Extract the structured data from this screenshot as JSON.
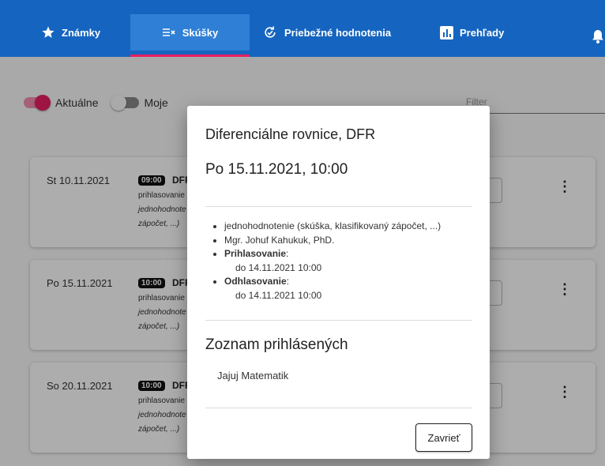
{
  "nav": {
    "tabs": [
      {
        "label": "Známky",
        "icon": "star-icon"
      },
      {
        "label": "Skúšky",
        "icon": "list-check-icon"
      },
      {
        "label": "Priebežné hodnotenia",
        "icon": "refresh-check-icon"
      },
      {
        "label": "Prehľady",
        "icon": "chart-box-icon"
      }
    ],
    "active_tab": "Skúšky",
    "colors": {
      "bar": "#1565c0",
      "active": "#2f7fd6",
      "accent": "#e91e63"
    }
  },
  "filters": {
    "current_label": "Aktuálne",
    "current_on": true,
    "mine_label": "Moje",
    "mine_on": false,
    "filter_placeholder": "Filter"
  },
  "exams": [
    {
      "date": "St 10.11.2021",
      "time": "09:00",
      "code": "DFR",
      "line1": "prihlasovanie",
      "line2": "jednohodnote",
      "line3": "zápočet, ...)"
    },
    {
      "date": "Po 15.11.2021",
      "time": "10:00",
      "code": "DFR",
      "line1": "prihlasovanie",
      "line2": "jednohodnote",
      "line3": "zápočet, ...)"
    },
    {
      "date": "So 20.11.2021",
      "time": "10:00",
      "code": "DFR",
      "line1": "prihlasovanie",
      "line2": "jednohodnote",
      "line3": "zápočet, ...)"
    }
  ],
  "dialog": {
    "title": "Diferenciálne rovnice, DFR",
    "datetime": "Po 15.11.2021, 10:00",
    "details": {
      "type": "jednohodnotenie (skúška, klasifikovaný zápočet, ...)",
      "examiner": "Mgr. Johuf Kahukuk, PhD.",
      "signup_label": "Prihlasovanie",
      "signup_value": "do 14.11.2021 10:00",
      "signoff_label": "Odhlasovanie",
      "signoff_value": "do 14.11.2021 10:00"
    },
    "registered_heading": "Zoznam prihlásených",
    "registered": [
      "Jajuj Matematik"
    ],
    "close_label": "Zavrieť"
  }
}
